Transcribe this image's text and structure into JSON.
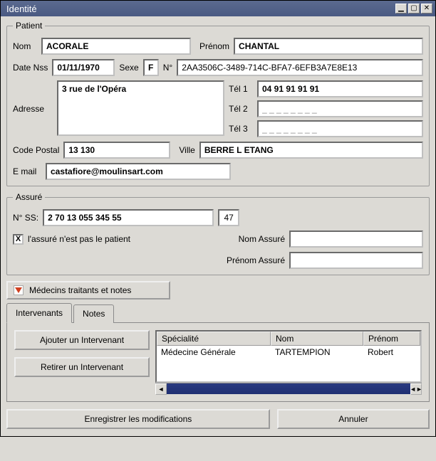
{
  "window": {
    "title": "Identité"
  },
  "patient": {
    "legend": "Patient",
    "nom_label": "Nom",
    "nom": "ACORALE",
    "prenom_label": "Prénom",
    "prenom": "CHANTAL",
    "date_nss_label": "Date Nss",
    "date_nss": "01/11/1970",
    "sexe_label": "Sexe",
    "sexe": "F",
    "num_label": "N°",
    "num": "2AA3506C-3489-714C-BFA7-6EFB3A7E8E13",
    "adresse_label": "Adresse",
    "adresse": "3 rue de l'Opéra",
    "tel1_label": "Tél 1",
    "tel1": "04 91 91 91 91",
    "tel2_label": "Tél 2",
    "tel2": "_ _ _ _ _ _ _ _",
    "tel3_label": "Tél 3",
    "tel3": "_ _ _ _ _ _ _ _",
    "cp_label": "Code Postal",
    "cp": "13 130",
    "ville_label": "Ville",
    "ville": "BERRE L ETANG",
    "email_label": "E mail",
    "email": "castafiore@moulinsart.com"
  },
  "assure": {
    "legend": "Assuré",
    "nss_label": "N° SS:",
    "nss": "2 70 13 055 345 55",
    "nss_key": "47",
    "not_patient_label": "l'assuré n'est pas le patient",
    "not_patient_checked": true,
    "nom_label": "Nom Assuré",
    "nom": "",
    "prenom_label": "Prénom Assuré",
    "prenom": ""
  },
  "section_header": "Médecins traitants et notes",
  "tabs": {
    "intervenants": "Intervenants",
    "notes": "Notes"
  },
  "panel": {
    "add_btn": "Ajouter un Intervenant",
    "remove_btn": "Retirer un Intervenant",
    "columns": {
      "spec": "Spécialité",
      "nom": "Nom",
      "prenom": "Prénom"
    },
    "rows": [
      {
        "spec": "Médecine Générale",
        "nom": "TARTEMPION",
        "prenom": "Robert"
      }
    ]
  },
  "footer": {
    "save": "Enregistrer les modifications",
    "cancel": "Annuler"
  }
}
